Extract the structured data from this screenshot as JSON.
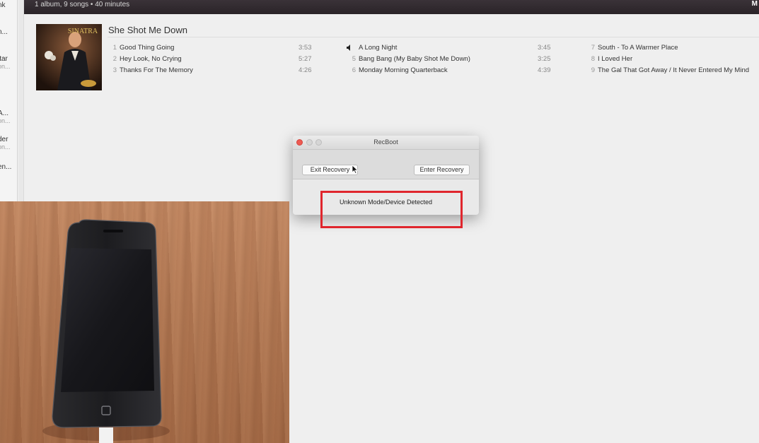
{
  "topbar": {
    "summary": "1 album, 9 songs • 40 minutes",
    "right_letter": "M"
  },
  "sidebar": {
    "items": [
      {
        "title": "nk",
        "subtitle": ""
      },
      {
        "title": "n...",
        "subtitle": ""
      },
      {
        "title": "itar",
        "subtitle": "on..."
      },
      {
        "title": "A...",
        "subtitle": "on..."
      },
      {
        "title": "der",
        "subtitle": "on..."
      },
      {
        "title": "en...",
        "subtitle": ""
      }
    ]
  },
  "album": {
    "title": "She Shot Me Down",
    "cover_text": "SINATRA",
    "tracks": [
      {
        "num": "1",
        "name": "Good Thing Going",
        "dur": "3:53"
      },
      {
        "num": "2",
        "name": "Hey Look, No Crying",
        "dur": "5:27"
      },
      {
        "num": "3",
        "name": "Thanks For The Memory",
        "dur": "4:26"
      },
      {
        "num": "",
        "name": "A Long Night",
        "dur": "3:45",
        "playing": true
      },
      {
        "num": "5",
        "name": "Bang Bang (My Baby Shot Me Down)",
        "dur": "3:25"
      },
      {
        "num": "6",
        "name": "Monday Morning Quarterback",
        "dur": "4:39"
      },
      {
        "num": "7",
        "name": "South - To A Warmer Place",
        "dur": ""
      },
      {
        "num": "8",
        "name": "I Loved Her",
        "dur": ""
      },
      {
        "num": "9",
        "name": "The Gal That Got Away / It Never Entered My Mind",
        "dur": ""
      }
    ]
  },
  "dialog": {
    "title": "RecBoot",
    "exit_label": "Exit Recovery",
    "enter_label": "Enter Recovery",
    "status": "Unknown Mode/Device Detected"
  },
  "colors": {
    "highlight": "#e0262d",
    "close_light": "#ee5a52"
  }
}
